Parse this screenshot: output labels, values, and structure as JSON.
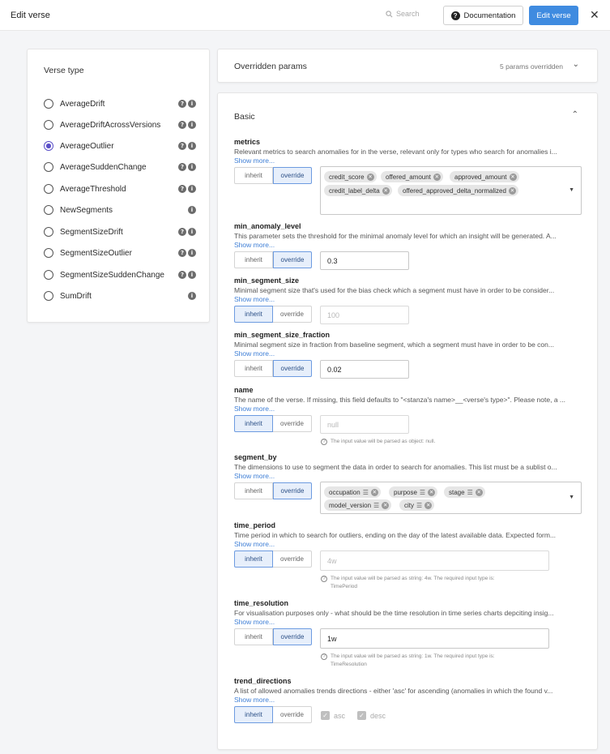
{
  "header": {
    "title": "Edit verse",
    "search_label": "Search",
    "documentation_label": "Documentation",
    "edit_verse_label": "Edit verse",
    "close_glyph": "✕"
  },
  "verse_type": {
    "heading": "Verse type",
    "selected": "AverageOutlier",
    "items": [
      {
        "label": "AverageDrift",
        "icons": [
          "help-icon",
          "info-icon"
        ]
      },
      {
        "label": "AverageDriftAcrossVersions",
        "icons": [
          "help-icon",
          "info-icon"
        ]
      },
      {
        "label": "AverageOutlier",
        "icons": [
          "help-icon",
          "info-icon"
        ]
      },
      {
        "label": "AverageSuddenChange",
        "icons": [
          "help-icon",
          "info-icon"
        ]
      },
      {
        "label": "AverageThreshold",
        "icons": [
          "help-icon",
          "info-icon"
        ]
      },
      {
        "label": "NewSegments",
        "icons": [
          "info-icon"
        ]
      },
      {
        "label": "SegmentSizeDrift",
        "icons": [
          "help-icon",
          "info-icon"
        ]
      },
      {
        "label": "SegmentSizeOutlier",
        "icons": [
          "help-icon",
          "info-icon"
        ]
      },
      {
        "label": "SegmentSizeSuddenChange",
        "icons": [
          "help-icon",
          "info-icon"
        ]
      },
      {
        "label": "SumDrift",
        "icons": [
          "info-icon"
        ]
      }
    ]
  },
  "overridden": {
    "label": "Overridden params",
    "count_text": "5 params overridden"
  },
  "basic": {
    "title": "Basic",
    "inherit_label": "inherit",
    "override_label": "override",
    "show_more": "Show more...",
    "params": {
      "metrics": {
        "name": "metrics",
        "desc": "Relevant metrics to search anomalies for in the verse, relevant only for types who search for anomalies i...",
        "mode": "override",
        "chips": [
          "credit_score",
          "offered_amount",
          "approved_amount",
          "credit_label_delta",
          "offered_approved_delta_normalized"
        ]
      },
      "min_anomaly_level": {
        "name": "min_anomaly_level",
        "desc": "This parameter sets the threshold for the minimal anomaly level for which an insight will be generated. A...",
        "mode": "override",
        "value": "0.3"
      },
      "min_segment_size": {
        "name": "min_segment_size",
        "desc": "Minimal segment size that's used for the bias check which a segment must have in order to be consider...",
        "mode": "inherit",
        "value": "100"
      },
      "min_segment_size_fraction": {
        "name": "min_segment_size_fraction",
        "desc": "Minimal segment size in fraction from baseline segment, which a segment must have in order to be con...",
        "mode": "override",
        "value": "0.02"
      },
      "name": {
        "name": "name",
        "desc": "The name of the verse. If missing, this field defaults to \"<stanza's name>__<verse's type>\". Please note, a ...",
        "mode": "inherit",
        "value": "null",
        "hint": "The input value will be parsed as object: null."
      },
      "segment_by": {
        "name": "segment_by",
        "desc": "The dimensions to use to segment the data in order to search for anomalies. This list must be a sublist o...",
        "mode": "override",
        "chips": [
          "occupation",
          "purpose",
          "stage",
          "model_version",
          "city"
        ]
      },
      "time_period": {
        "name": "time_period",
        "desc": "Time period in which to search for outliers, ending on the day of the latest available data. Expected form...",
        "mode": "inherit",
        "value": "4w",
        "hint_line1": "The input value will be parsed as string: 4w. The required input type is:",
        "hint_line2": "TimePeriod"
      },
      "time_resolution": {
        "name": "time_resolution",
        "desc": "For visualisation purposes only - what should be the time resolution in time series charts depciting insig...",
        "mode": "override",
        "value": "1w",
        "hint_line1": "The input value will be parsed as string: 1w. The required input type is:",
        "hint_line2": "TimeResolution"
      },
      "trend_directions": {
        "name": "trend_directions",
        "desc": "A list of allowed anomalies trends directions - either 'asc' for ascending (anomalies in which the found v...",
        "mode": "inherit",
        "options": [
          "asc",
          "desc"
        ]
      }
    }
  },
  "colors": {
    "accent": "#3f8be0",
    "radio_selected": "#5a4fc8",
    "link": "#3f7fd6"
  }
}
